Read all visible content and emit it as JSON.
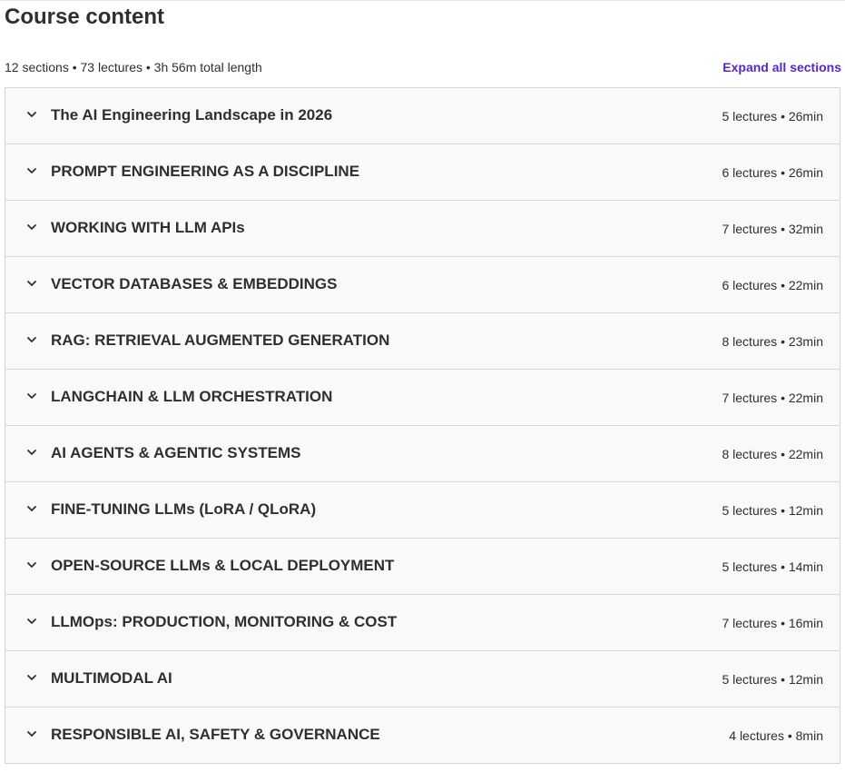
{
  "header": {
    "title": "Course content",
    "summary": "12 sections • 73 lectures • 3h 56m total length",
    "expand_label": "Expand all sections"
  },
  "colors": {
    "accent": "#5624d0",
    "section_bg": "#f7f9fa",
    "border": "#d1d7dc"
  },
  "sections": [
    {
      "title": "The AI Engineering Landscape in 2026",
      "meta": "5 lectures • 26min",
      "icon": "chevron-down-icon"
    },
    {
      "title": "PROMPT ENGINEERING AS A DISCIPLINE",
      "meta": "6 lectures • 26min",
      "icon": "chevron-down-icon"
    },
    {
      "title": "WORKING WITH LLM APIs",
      "meta": "7 lectures • 32min",
      "icon": "chevron-down-icon"
    },
    {
      "title": "VECTOR DATABASES & EMBEDDINGS",
      "meta": "6 lectures • 22min",
      "icon": "chevron-down-icon"
    },
    {
      "title": "RAG: RETRIEVAL AUGMENTED GENERATION",
      "meta": "8 lectures • 23min",
      "icon": "chevron-down-icon"
    },
    {
      "title": "LANGCHAIN & LLM ORCHESTRATION",
      "meta": "7 lectures • 22min",
      "icon": "chevron-down-icon"
    },
    {
      "title": "AI AGENTS & AGENTIC SYSTEMS",
      "meta": "8 lectures • 22min",
      "icon": "chevron-down-icon"
    },
    {
      "title": "FINE-TUNING LLMs (LoRA / QLoRA)",
      "meta": "5 lectures • 12min",
      "icon": "chevron-down-icon"
    },
    {
      "title": "OPEN-SOURCE LLMs & LOCAL DEPLOYMENT",
      "meta": "5 lectures • 14min",
      "icon": "chevron-down-icon"
    },
    {
      "title": "LLMOps: PRODUCTION, MONITORING & COST",
      "meta": "7 lectures • 16min",
      "icon": "chevron-down-icon"
    },
    {
      "title": "MULTIMODAL AI",
      "meta": "5 lectures • 12min",
      "icon": "chevron-down-icon"
    },
    {
      "title": "RESPONSIBLE AI, SAFETY & GOVERNANCE",
      "meta": "4 lectures • 8min",
      "icon": "chevron-down-icon"
    }
  ]
}
